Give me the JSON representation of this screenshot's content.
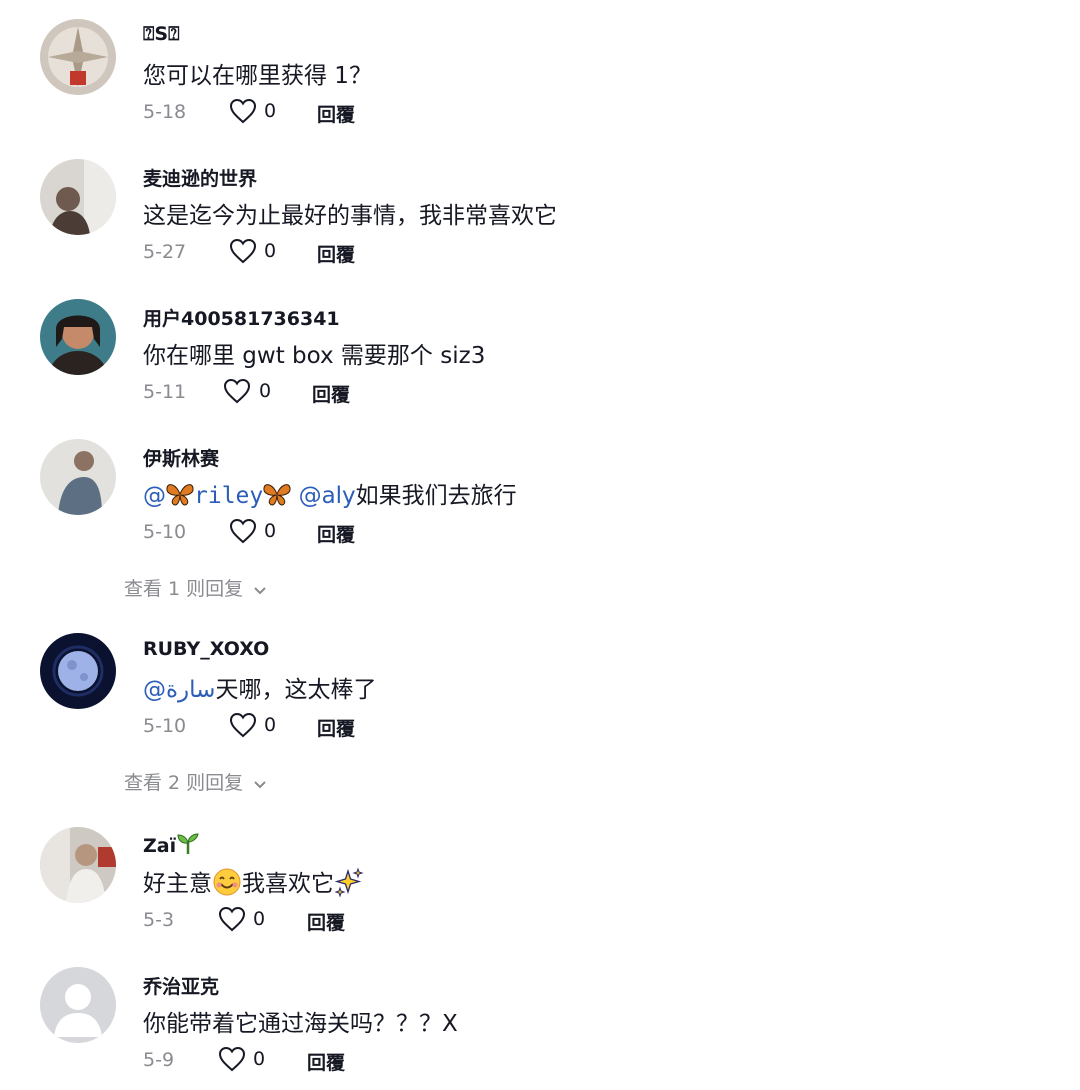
{
  "comments": [
    {
      "username": "⍰S⍰",
      "text": "您可以在哪里获得 1？",
      "date": "5-18",
      "likes": "0",
      "reply": "回覆"
    },
    {
      "username": "麦迪逊的世界",
      "text": "这是迄今为止最好的事情，我非常喜欢它",
      "date": "5-27",
      "likes": "0",
      "reply": "回覆"
    },
    {
      "username": "用户400581736341",
      "text": "你在哪里 gwt box 需要那个 siz3",
      "date": "5-11",
      "likes": "0",
      "reply": "回覆"
    },
    {
      "username": "伊斯林赛",
      "text_prefix": "@",
      "mention1": "riley",
      "mention2": "@aly",
      "text_suffix": "如果我们去旅行",
      "date": "5-10",
      "likes": "0",
      "reply": "回覆"
    },
    {
      "username": "RUBY_XOXO",
      "mention": "@سارة",
      "text_suffix": "天哪，这太棒了",
      "date": "5-10",
      "likes": "0",
      "reply": "回覆"
    },
    {
      "username": "Zaï",
      "text_a": "好主意",
      "text_b": "我喜欢它",
      "date": "5-3",
      "likes": "0",
      "reply": "回覆"
    },
    {
      "username": "乔治亚克",
      "text": "你能带着它通过海关吗？？？X",
      "date": "5-9",
      "likes": "0",
      "reply": "回覆"
    }
  ],
  "view_replies": [
    {
      "label": "查看 1 则回复"
    },
    {
      "label": "查看 2 则回复"
    }
  ],
  "icons": {
    "like": "heart-outline-icon",
    "expand": "chevron-down-icon",
    "butterfly": "butterfly-emoji",
    "sprout": "sprout-emoji",
    "smile": "smiling-hearts-emoji",
    "sparkles": "sparkles-emoji"
  },
  "colors": {
    "mention": "#2b5db9",
    "meta": "#8a8b91",
    "text": "#161823"
  }
}
